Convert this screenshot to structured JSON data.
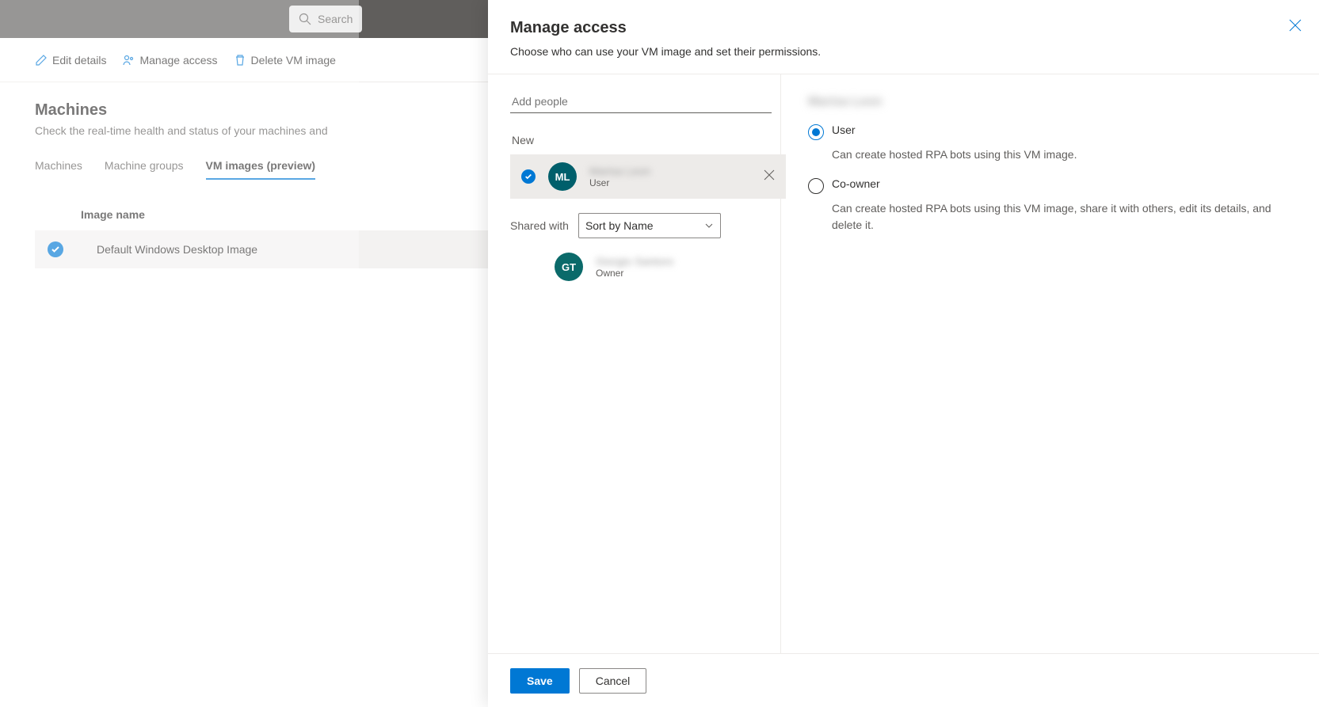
{
  "topbar": {
    "search_placeholder": "Search"
  },
  "toolbar": {
    "edit_details": "Edit details",
    "manage_access": "Manage access",
    "delete_vm": "Delete VM image"
  },
  "page": {
    "title": "Machines",
    "subtitle": "Check the real-time health and status of your machines and"
  },
  "tabs": {
    "machines": "Machines",
    "machine_groups": "Machine groups",
    "vm_images": "VM images (preview)"
  },
  "table": {
    "header_image_name": "Image name",
    "row0": "Default Windows Desktop Image"
  },
  "panel": {
    "title": "Manage access",
    "subtitle": "Choose who can use your VM image and set their permissions.",
    "add_people_placeholder": "Add people",
    "new_label": "New",
    "shared_with_label": "Shared with",
    "sort_by": "Sort by Name",
    "save": "Save",
    "cancel": "Cancel"
  },
  "people": {
    "new_person": {
      "initials": "ML",
      "name": "Marisa Leon",
      "role": "User",
      "avatar_bg": "#005f6b"
    },
    "shared_person": {
      "initials": "GT",
      "name": "Giorgio Santoro",
      "role": "Owner",
      "avatar_bg": "#0b6a6a"
    }
  },
  "permissions": {
    "selected_name": "Marisa Leon",
    "user_label": "User",
    "user_desc": "Can create hosted RPA bots using this VM image.",
    "coowner_label": "Co-owner",
    "coowner_desc": "Can create hosted RPA bots using this VM image, share it with others, edit its details, and delete it."
  }
}
